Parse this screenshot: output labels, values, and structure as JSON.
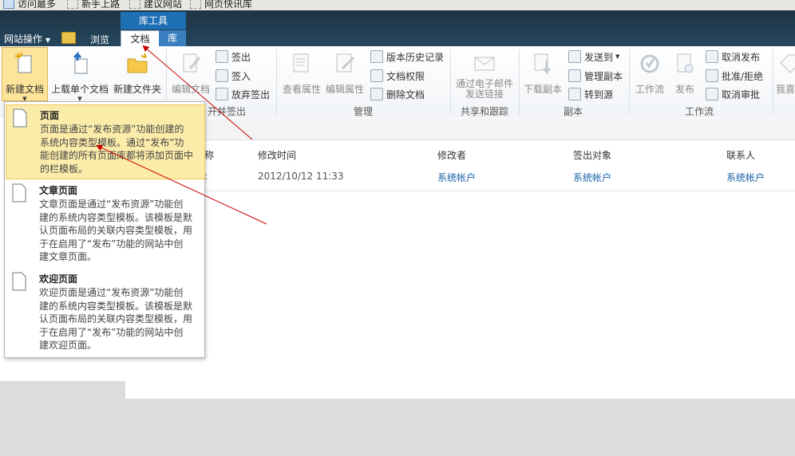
{
  "favorites": [
    "访问最多",
    "新手上路",
    "建议网站",
    "网页快讯库"
  ],
  "header": {
    "site_actions": "网站操作",
    "browse_tab": "浏览",
    "context_group": "库工具",
    "doc_tab": "文档",
    "lib_tab": "库"
  },
  "ribbon": {
    "new_doc": "新建文档",
    "upload": "上载单个文档",
    "new_folder": "新建文件夹",
    "edit_doc": "编辑文档",
    "check_out": "签出",
    "check_in": "签入",
    "discard_checkout": "放弃签出",
    "open_checkout_group": "开并签出",
    "view_props": "查看属性",
    "edit_props": "编辑属性",
    "version_history": "版本历史记录",
    "doc_permissions": "文档权限",
    "delete_doc": "删除文档",
    "manage_group": "管理",
    "email_link": "通过电子邮件\n发送链接",
    "share_group": "共享和跟踪",
    "download_copy": "下载副本",
    "send_to": "发送到",
    "manage_copies": "管理副本",
    "go_to_source": "转到源",
    "copies_group": "副本",
    "workflows": "工作流",
    "publish": "发布",
    "unpublish": "取消发布",
    "approve_reject": "批准/拒绝",
    "cancel_approval": "取消审批",
    "workflow_group": "工作流",
    "more": "我喜"
  },
  "table": {
    "columns": [
      "称",
      "修改时间",
      "修改者",
      "签出对象",
      "联系人"
    ],
    "row": {
      "name_tail": ":",
      "modified": "2012/10/12 11:33",
      "modified_by": "系统帐户",
      "checked_out_to": "系统帐户",
      "contact": "系统帐户"
    }
  },
  "menu": [
    {
      "title": "页面",
      "desc": "页面是通过“发布资源”功能创建的\n系统内容类型模板。通过“发布”功\n能创建的所有页面库都将添加页面中\n的栏模板。"
    },
    {
      "title": "文章页面",
      "desc": "文章页面是通过“发布资源”功能创\n建的系统内容类型模板。该模板是默\n认页面布局的关联内容类型模板，用\n于在启用了“发布”功能的网站中创\n建文章页面。"
    },
    {
      "title": "欢迎页面",
      "desc": "欢迎页面是通过“发布资源”功能创\n建的系统内容类型模板。该模板是默\n认页面布局的关联内容类型模板，用\n于在启用了“发布”功能的网站中创\n建欢迎页面。"
    }
  ],
  "colors": {
    "annotation": "#cc0000",
    "accent": "#1f6fb5",
    "link": "#1a62a8",
    "highlight": "#fcecaa"
  }
}
